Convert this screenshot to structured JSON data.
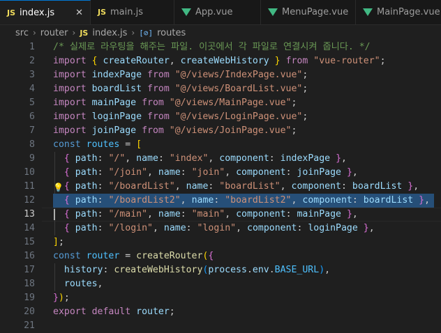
{
  "tabs": [
    {
      "label": "index.js",
      "icon": "JS",
      "active": true,
      "close": "✕"
    },
    {
      "label": "main.js",
      "icon": "JS"
    },
    {
      "label": "App.vue",
      "icon": "vue"
    },
    {
      "label": "MenuPage.vue",
      "icon": "vue"
    },
    {
      "label": "MainPage.vue",
      "icon": "vue"
    }
  ],
  "breadcrumb": {
    "parts": [
      "src",
      "router",
      "index.js",
      "routes"
    ],
    "file_icon": "JS",
    "symbol_icon": "[⊘]"
  },
  "editor": {
    "current_line": 13,
    "highlighted_line": 12,
    "lines": [
      {
        "n": "1",
        "tokens": [
          [
            "c-cmt",
            "/* 실제로 라우팅을 해주는 파일. 이곳에서 각 파일로 연결시켜 줍니다. */"
          ]
        ]
      },
      {
        "n": "2",
        "tokens": [
          [
            "c-kw",
            "import"
          ],
          [
            "c-plain",
            " "
          ],
          [
            "c-br1",
            "{"
          ],
          [
            "c-plain",
            " "
          ],
          [
            "c-var",
            "createRouter"
          ],
          [
            "c-plain",
            ", "
          ],
          [
            "c-var",
            "createWebHistory"
          ],
          [
            "c-plain",
            " "
          ],
          [
            "c-br1",
            "}"
          ],
          [
            "c-plain",
            " "
          ],
          [
            "c-kw",
            "from"
          ],
          [
            "c-plain",
            " "
          ],
          [
            "c-str",
            "\"vue-router\""
          ],
          [
            "c-plain",
            ";"
          ]
        ]
      },
      {
        "n": "3",
        "tokens": [
          [
            "c-kw",
            "import"
          ],
          [
            "c-plain",
            " "
          ],
          [
            "c-var",
            "indexPage"
          ],
          [
            "c-plain",
            " "
          ],
          [
            "c-kw",
            "from"
          ],
          [
            "c-plain",
            " "
          ],
          [
            "c-str",
            "\"@/views/IndexPage.vue\""
          ],
          [
            "c-plain",
            ";"
          ]
        ]
      },
      {
        "n": "4",
        "tokens": [
          [
            "c-kw",
            "import"
          ],
          [
            "c-plain",
            " "
          ],
          [
            "c-var",
            "boardList"
          ],
          [
            "c-plain",
            " "
          ],
          [
            "c-kw",
            "from"
          ],
          [
            "c-plain",
            " "
          ],
          [
            "c-str",
            "\"@/views/BoardList.vue\""
          ],
          [
            "c-plain",
            ";"
          ]
        ]
      },
      {
        "n": "5",
        "tokens": [
          [
            "c-kw",
            "import"
          ],
          [
            "c-plain",
            " "
          ],
          [
            "c-var",
            "mainPage"
          ],
          [
            "c-plain",
            " "
          ],
          [
            "c-kw",
            "from"
          ],
          [
            "c-plain",
            " "
          ],
          [
            "c-str",
            "\"@/views/MainPage.vue\""
          ],
          [
            "c-plain",
            ";"
          ]
        ]
      },
      {
        "n": "6",
        "tokens": [
          [
            "c-kw",
            "import"
          ],
          [
            "c-plain",
            " "
          ],
          [
            "c-var",
            "loginPage"
          ],
          [
            "c-plain",
            " "
          ],
          [
            "c-kw",
            "from"
          ],
          [
            "c-plain",
            " "
          ],
          [
            "c-str",
            "\"@/views/LoginPage.vue\""
          ],
          [
            "c-plain",
            ";"
          ]
        ]
      },
      {
        "n": "7",
        "tokens": [
          [
            "c-kw",
            "import"
          ],
          [
            "c-plain",
            " "
          ],
          [
            "c-var",
            "joinPage"
          ],
          [
            "c-plain",
            " "
          ],
          [
            "c-kw",
            "from"
          ],
          [
            "c-plain",
            " "
          ],
          [
            "c-str",
            "\"@/views/JoinPage.vue\""
          ],
          [
            "c-plain",
            ";"
          ]
        ]
      },
      {
        "n": "8",
        "tokens": [
          [
            "c-decl",
            "const"
          ],
          [
            "c-plain",
            " "
          ],
          [
            "c-const",
            "routes"
          ],
          [
            "c-plain",
            " = "
          ],
          [
            "c-br1",
            "["
          ]
        ]
      },
      {
        "n": "9",
        "tokens": [
          [
            "c-plain",
            "  "
          ],
          [
            "c-br2",
            "{"
          ],
          [
            "c-plain",
            " "
          ],
          [
            "c-var",
            "path"
          ],
          [
            "c-plain",
            ": "
          ],
          [
            "c-str",
            "\"/\""
          ],
          [
            "c-plain",
            ", "
          ],
          [
            "c-var",
            "name"
          ],
          [
            "c-plain",
            ": "
          ],
          [
            "c-str",
            "\"index\""
          ],
          [
            "c-plain",
            ", "
          ],
          [
            "c-var",
            "component"
          ],
          [
            "c-plain",
            ": "
          ],
          [
            "c-var",
            "indexPage"
          ],
          [
            "c-plain",
            " "
          ],
          [
            "c-br2",
            "}"
          ],
          [
            "c-plain",
            ","
          ]
        ]
      },
      {
        "n": "10",
        "tokens": [
          [
            "c-plain",
            "  "
          ],
          [
            "c-br2",
            "{"
          ],
          [
            "c-plain",
            " "
          ],
          [
            "c-var",
            "path"
          ],
          [
            "c-plain",
            ": "
          ],
          [
            "c-str",
            "\"/join\""
          ],
          [
            "c-plain",
            ", "
          ],
          [
            "c-var",
            "name"
          ],
          [
            "c-plain",
            ": "
          ],
          [
            "c-str",
            "\"join\""
          ],
          [
            "c-plain",
            ", "
          ],
          [
            "c-var",
            "component"
          ],
          [
            "c-plain",
            ": "
          ],
          [
            "c-var",
            "joinPage"
          ],
          [
            "c-plain",
            " "
          ],
          [
            "c-br2",
            "}"
          ],
          [
            "c-plain",
            ","
          ]
        ]
      },
      {
        "n": "11",
        "bulb": true,
        "tokens": [
          [
            "c-plain",
            "  "
          ],
          [
            "c-br2",
            "{"
          ],
          [
            "c-plain",
            " "
          ],
          [
            "c-var",
            "path"
          ],
          [
            "c-plain",
            ": "
          ],
          [
            "c-str",
            "\"/boardList\""
          ],
          [
            "c-plain",
            ", "
          ],
          [
            "c-var",
            "name"
          ],
          [
            "c-plain",
            ": "
          ],
          [
            "c-str",
            "\"boardList\""
          ],
          [
            "c-plain",
            ", "
          ],
          [
            "c-var",
            "component"
          ],
          [
            "c-plain",
            ": "
          ],
          [
            "c-var",
            "boardList"
          ],
          [
            "c-plain",
            " "
          ],
          [
            "c-br2",
            "}"
          ],
          [
            "c-plain",
            ","
          ]
        ]
      },
      {
        "n": "12",
        "tokens": [
          [
            "c-plain",
            "  "
          ],
          [
            "c-br2",
            "{"
          ],
          [
            "c-plain",
            " "
          ],
          [
            "c-var",
            "path"
          ],
          [
            "c-plain",
            ": "
          ],
          [
            "c-str",
            "\"/boardList2\""
          ],
          [
            "c-plain",
            ", "
          ],
          [
            "c-var",
            "name"
          ],
          [
            "c-plain",
            ": "
          ],
          [
            "c-str",
            "\"boardList2\""
          ],
          [
            "c-plain",
            ", "
          ],
          [
            "c-var",
            "component"
          ],
          [
            "c-plain",
            ": "
          ],
          [
            "c-var",
            "boardList"
          ],
          [
            "c-plain",
            " "
          ],
          [
            "c-br2",
            "}"
          ],
          [
            "c-plain",
            ","
          ]
        ]
      },
      {
        "n": "13",
        "tokens": [
          [
            "c-plain",
            "  "
          ],
          [
            "c-br2",
            "{"
          ],
          [
            "c-plain",
            " "
          ],
          [
            "c-var",
            "path"
          ],
          [
            "c-plain",
            ": "
          ],
          [
            "c-str",
            "\"/main\""
          ],
          [
            "c-plain",
            ", "
          ],
          [
            "c-var",
            "name"
          ],
          [
            "c-plain",
            ": "
          ],
          [
            "c-str",
            "\"main\""
          ],
          [
            "c-plain",
            ", "
          ],
          [
            "c-var",
            "component"
          ],
          [
            "c-plain",
            ": "
          ],
          [
            "c-var",
            "mainPage"
          ],
          [
            "c-plain",
            " "
          ],
          [
            "c-br2",
            "}"
          ],
          [
            "c-plain",
            ","
          ]
        ]
      },
      {
        "n": "14",
        "tokens": [
          [
            "c-plain",
            "  "
          ],
          [
            "c-br2",
            "{"
          ],
          [
            "c-plain",
            " "
          ],
          [
            "c-var",
            "path"
          ],
          [
            "c-plain",
            ": "
          ],
          [
            "c-str",
            "\"/login\""
          ],
          [
            "c-plain",
            ", "
          ],
          [
            "c-var",
            "name"
          ],
          [
            "c-plain",
            ": "
          ],
          [
            "c-str",
            "\"login\""
          ],
          [
            "c-plain",
            ", "
          ],
          [
            "c-var",
            "component"
          ],
          [
            "c-plain",
            ": "
          ],
          [
            "c-var",
            "loginPage"
          ],
          [
            "c-plain",
            " "
          ],
          [
            "c-br2",
            "}"
          ],
          [
            "c-plain",
            ","
          ]
        ]
      },
      {
        "n": "15",
        "tokens": [
          [
            "c-br1",
            "]"
          ],
          [
            "c-plain",
            ";"
          ]
        ]
      },
      {
        "n": "16",
        "tokens": [
          [
            "c-decl",
            "const"
          ],
          [
            "c-plain",
            " "
          ],
          [
            "c-const",
            "router"
          ],
          [
            "c-plain",
            " = "
          ],
          [
            "c-fn",
            "createRouter"
          ],
          [
            "c-br1",
            "("
          ],
          [
            "c-br2",
            "{"
          ]
        ]
      },
      {
        "n": "17",
        "tokens": [
          [
            "c-plain",
            "  "
          ],
          [
            "c-var",
            "history"
          ],
          [
            "c-plain",
            ": "
          ],
          [
            "c-fn",
            "createWebHistory"
          ],
          [
            "c-br3",
            "("
          ],
          [
            "c-var",
            "process"
          ],
          [
            "c-plain",
            "."
          ],
          [
            "c-var",
            "env"
          ],
          [
            "c-plain",
            "."
          ],
          [
            "c-const",
            "BASE_URL"
          ],
          [
            "c-br3",
            ")"
          ],
          [
            "c-plain",
            ","
          ]
        ]
      },
      {
        "n": "18",
        "tokens": [
          [
            "c-plain",
            "  "
          ],
          [
            "c-var",
            "routes"
          ],
          [
            "c-plain",
            ","
          ]
        ]
      },
      {
        "n": "19",
        "tokens": [
          [
            "c-br2",
            "}"
          ],
          [
            "c-br1",
            ")"
          ],
          [
            "c-plain",
            ";"
          ]
        ]
      },
      {
        "n": "20",
        "tokens": [
          [
            "c-kw",
            "export"
          ],
          [
            "c-plain",
            " "
          ],
          [
            "c-kw",
            "default"
          ],
          [
            "c-plain",
            " "
          ],
          [
            "c-var",
            "router"
          ],
          [
            "c-plain",
            ";"
          ]
        ]
      },
      {
        "n": "21",
        "tokens": []
      }
    ]
  }
}
